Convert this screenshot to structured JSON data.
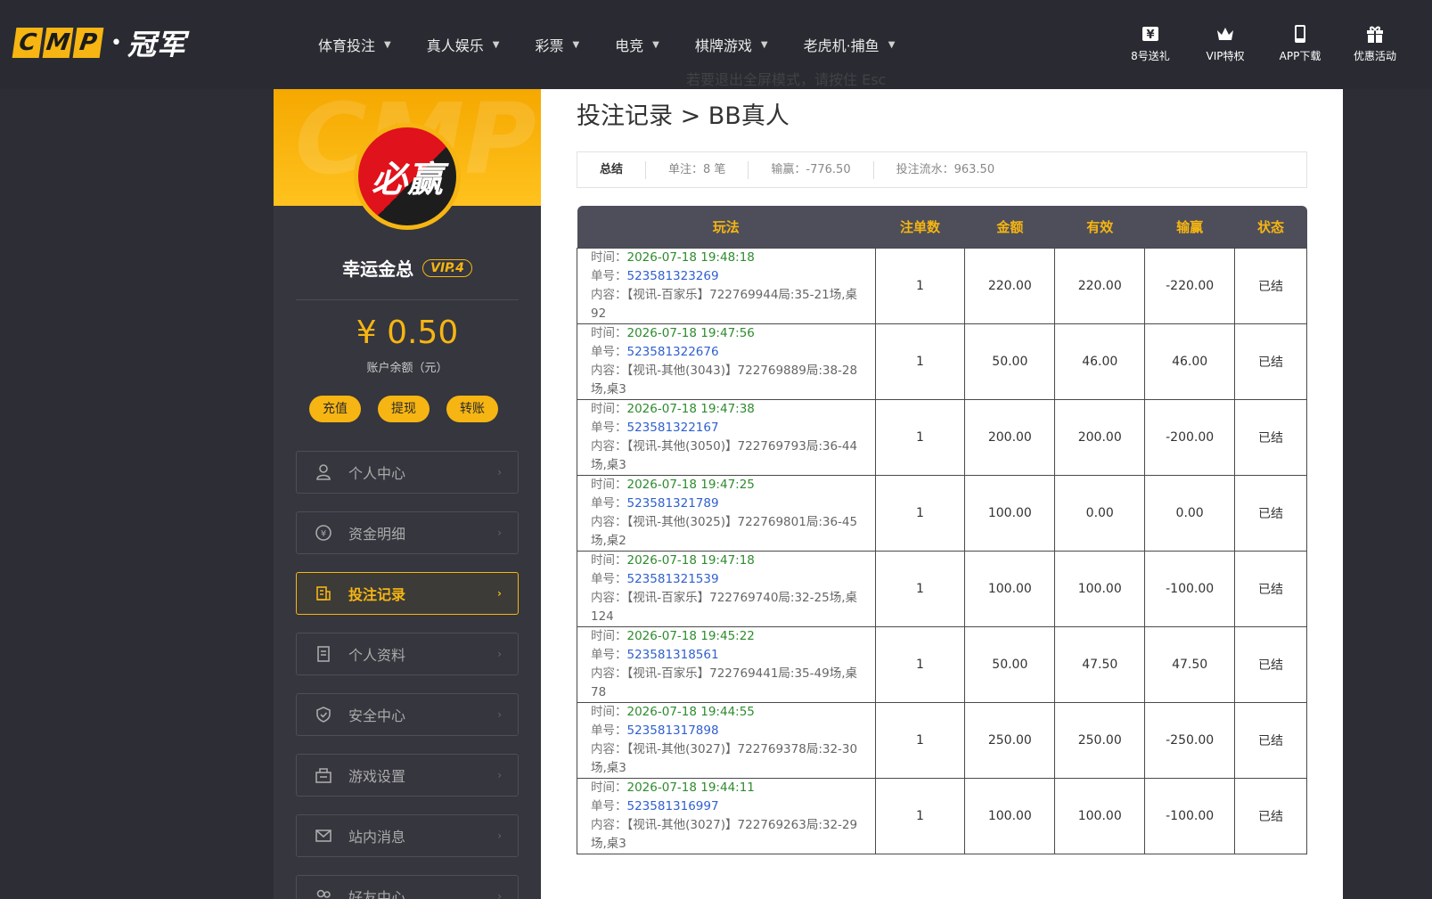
{
  "header": {
    "logo_letters": [
      "C",
      "M",
      "P"
    ],
    "logo_dot": "•",
    "logo_cn": "冠军",
    "nav": [
      {
        "label": "体育投注"
      },
      {
        "label": "真人娱乐"
      },
      {
        "label": "彩票"
      },
      {
        "label": "电竞"
      },
      {
        "label": "棋牌游戏"
      },
      {
        "label": "老虎机·捕鱼"
      }
    ],
    "actions": [
      {
        "label": "8号送礼",
        "icon": "yuan-ticket-icon"
      },
      {
        "label": "VIP特权",
        "icon": "crown-icon"
      },
      {
        "label": "APP下载",
        "icon": "phone-icon"
      },
      {
        "label": "优惠活动",
        "icon": "gift-icon"
      }
    ]
  },
  "esc_hint": "若要退出全屏模式，请按住 Esc",
  "sidebar": {
    "avatar_text": "必赢",
    "watermark": "CMP",
    "username": "幸运金总",
    "vip": "VIP.4",
    "balance": "¥ 0.50",
    "balance_label": "账户余额（元）",
    "buttons": [
      "充值",
      "提现",
      "转账"
    ],
    "menu": [
      {
        "label": "个人中心",
        "icon": "user-icon"
      },
      {
        "label": "资金明细",
        "icon": "money-icon"
      },
      {
        "label": "投注记录",
        "icon": "record-icon",
        "active": true
      },
      {
        "label": "个人资料",
        "icon": "profile-icon"
      },
      {
        "label": "安全中心",
        "icon": "shield-icon"
      },
      {
        "label": "游戏设置",
        "icon": "settings-icon"
      },
      {
        "label": "站内消息",
        "icon": "mail-icon"
      },
      {
        "label": "好友中心",
        "icon": "friends-icon"
      }
    ],
    "arrow": "›"
  },
  "main": {
    "title": "投注记录 > BB真人",
    "summary": {
      "label": "总结",
      "count": "单注：8 笔",
      "winloss": "输赢：-776.50",
      "turnover": "投注流水：963.50"
    },
    "columns": [
      "玩法",
      "注单数",
      "金额",
      "有效",
      "输赢",
      "状态"
    ],
    "labels": {
      "time": "时间：",
      "id": "单号：",
      "content": "内容："
    },
    "rows": [
      {
        "time": "2026-07-18 19:48:18",
        "id": "523581323269",
        "content": "【视讯-百家乐】722769944局:35-21场,桌92",
        "count": "1",
        "amount": "220.00",
        "valid": "220.00",
        "winloss": "-220.00",
        "sign": "neg",
        "status": "已结"
      },
      {
        "time": "2026-07-18 19:47:56",
        "id": "523581322676",
        "content": "【视讯-其他(3043)】722769889局:38-28场,桌3",
        "count": "1",
        "amount": "50.00",
        "valid": "46.00",
        "winloss": "46.00",
        "sign": "pos",
        "status": "已结"
      },
      {
        "time": "2026-07-18 19:47:38",
        "id": "523581322167",
        "content": "【视讯-其他(3050)】722769793局:36-44场,桌3",
        "count": "1",
        "amount": "200.00",
        "valid": "200.00",
        "winloss": "-200.00",
        "sign": "neg",
        "status": "已结"
      },
      {
        "time": "2026-07-18 19:47:25",
        "id": "523581321789",
        "content": "【视讯-其他(3025)】722769801局:36-45场,桌2",
        "count": "1",
        "amount": "100.00",
        "valid": "0.00",
        "winloss": "0.00",
        "sign": "zero",
        "status": "已结"
      },
      {
        "time": "2026-07-18 19:47:18",
        "id": "523581321539",
        "content": "【视讯-百家乐】722769740局:32-25场,桌124",
        "count": "1",
        "amount": "100.00",
        "valid": "100.00",
        "winloss": "-100.00",
        "sign": "neg",
        "status": "已结"
      },
      {
        "time": "2026-07-18 19:45:22",
        "id": "523581318561",
        "content": "【视讯-百家乐】722769441局:35-49场,桌78",
        "count": "1",
        "amount": "50.00",
        "valid": "47.50",
        "winloss": "47.50",
        "sign": "pos",
        "status": "已结"
      },
      {
        "time": "2026-07-18 19:44:55",
        "id": "523581317898",
        "content": "【视讯-其他(3027)】722769378局:32-30场,桌3",
        "count": "1",
        "amount": "250.00",
        "valid": "250.00",
        "winloss": "-250.00",
        "sign": "neg",
        "status": "已结"
      },
      {
        "time": "2026-07-18 19:44:11",
        "id": "523581316997",
        "content": "【视讯-其他(3027)】722769263局:32-29场,桌3",
        "count": "1",
        "amount": "100.00",
        "valid": "100.00",
        "winloss": "-100.00",
        "sign": "neg",
        "status": "已结"
      }
    ]
  },
  "colors": {
    "accent": "#f6b512",
    "negative": "#e0101b",
    "positive": "#2e8b2e",
    "link": "#2f5fd0"
  }
}
